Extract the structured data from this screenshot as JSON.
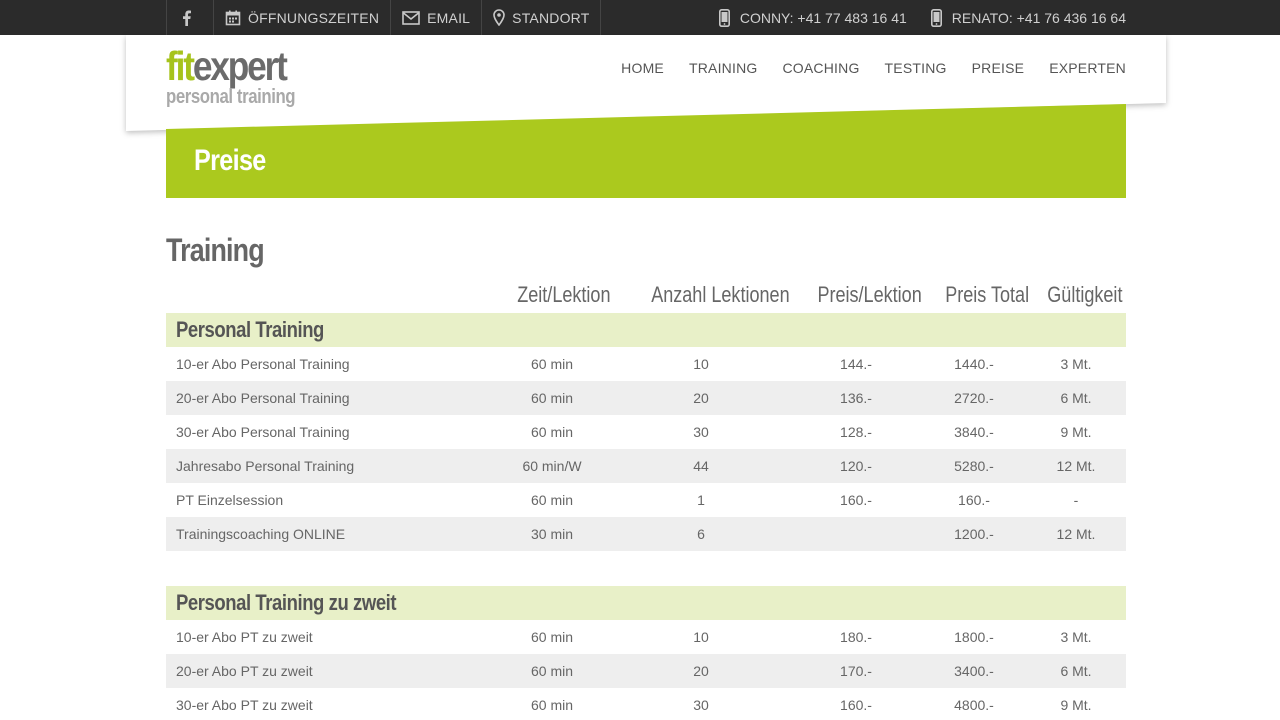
{
  "topbar": {
    "facebook_icon": "facebook-icon",
    "items": [
      {
        "label": "ÖFFNUNGSZEITEN",
        "icon": "calendar-icon"
      },
      {
        "label": "EMAIL",
        "icon": "envelope-icon"
      },
      {
        "label": "STANDORT",
        "icon": "location-pin-icon"
      }
    ],
    "phones": [
      {
        "label": "CONNY: +41 77 483 16 41",
        "icon": "mobile-phone-icon"
      },
      {
        "label": "RENATO: +41 76 436 16 64",
        "icon": "mobile-phone-icon"
      }
    ]
  },
  "logo": {
    "part1": "fit",
    "part2": "expert",
    "sub": "personal training"
  },
  "nav": [
    "HOME",
    "TRAINING",
    "COACHING",
    "TESTING",
    "PREISE",
    "EXPERTEN"
  ],
  "banner": {
    "title": "Preise"
  },
  "section": {
    "title": "Training"
  },
  "columns": [
    "Zeit/Lektion",
    "Anzahl Lektionen",
    "Preis/Lektion",
    "Preis Total",
    "Gültigkeit"
  ],
  "groups": [
    {
      "title": "Personal Training",
      "rows": [
        [
          "10-er Abo Personal Training",
          "60 min",
          "10",
          "144.-",
          "1440.-",
          "3 Mt."
        ],
        [
          "20-er Abo Personal Training",
          "60 min",
          "20",
          "136.-",
          "2720.-",
          "6 Mt."
        ],
        [
          "30-er Abo Personal Training",
          "60 min",
          "30",
          "128.-",
          "3840.-",
          "9 Mt."
        ],
        [
          "Jahresabo Personal Training",
          "60 min/W",
          "44",
          "120.-",
          "5280.-",
          "12 Mt."
        ],
        [
          "PT Einzelsession",
          "60 min",
          "1",
          "160.-",
          "160.-",
          "-"
        ],
        [
          "Trainingscoaching ONLINE",
          "30 min",
          "6",
          "",
          "1200.-",
          "12 Mt."
        ]
      ]
    },
    {
      "title": "Personal Training zu zweit",
      "rows": [
        [
          "10-er Abo PT zu zweit",
          "60 min",
          "10",
          "180.-",
          "1800.-",
          "3 Mt."
        ],
        [
          "20-er Abo PT zu zweit",
          "60 min",
          "20",
          "170.-",
          "3400.-",
          "6 Mt."
        ],
        [
          "30-er Abo PT zu zweit",
          "60 min",
          "30",
          "160.-",
          "4800.-",
          "9 Mt."
        ]
      ]
    }
  ],
  "colors": {
    "accent": "#abc91e",
    "topbar": "#2b2b2b",
    "group_bg": "#e8f0c8",
    "row_alt": "#eeeeee"
  }
}
